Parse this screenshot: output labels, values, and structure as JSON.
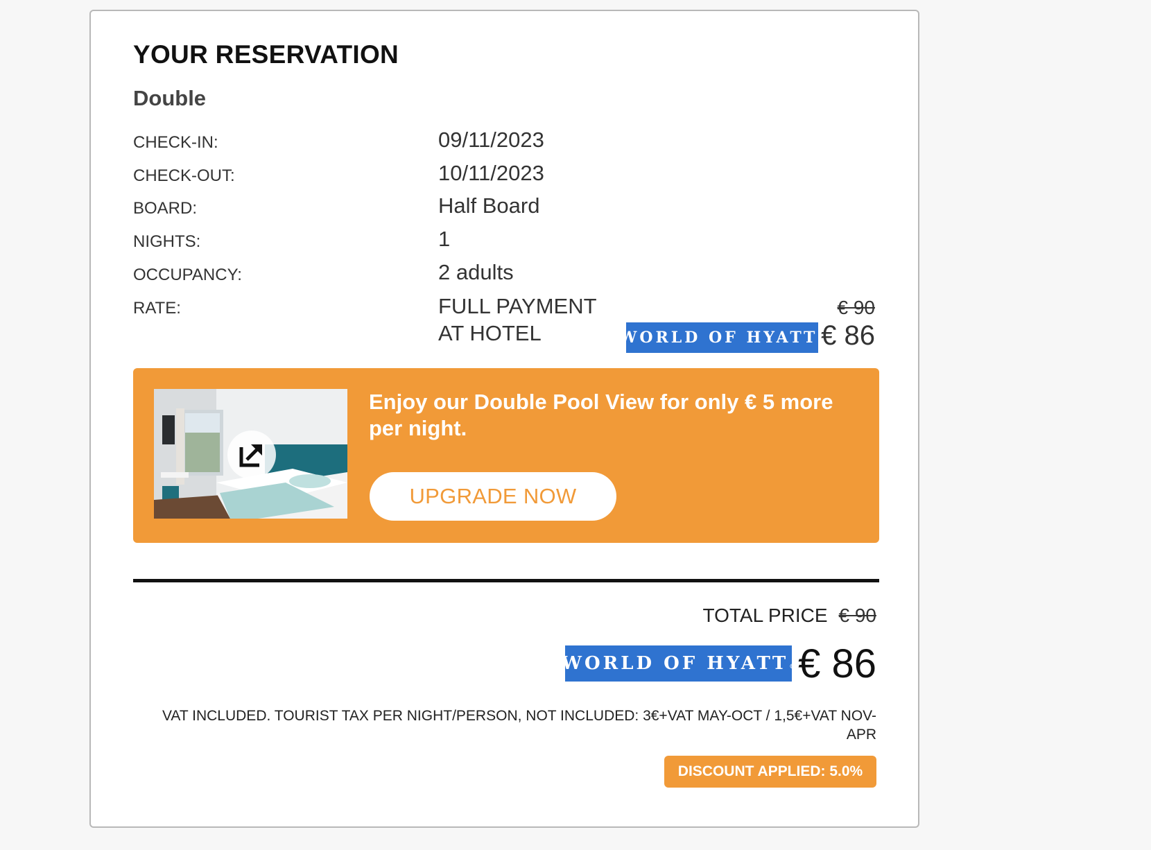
{
  "reservation": {
    "title": "YOUR RESERVATION",
    "room": "Double",
    "details": [
      {
        "label": "CHECK-IN:",
        "value": "09/11/2023"
      },
      {
        "label": "CHECK-OUT:",
        "value": "10/11/2023"
      },
      {
        "label": "BOARD:",
        "value": "Half Board"
      },
      {
        "label": "NIGHTS:",
        "value": "1"
      },
      {
        "label": "OCCUPANCY:",
        "value": "2 adults"
      }
    ],
    "rate": {
      "label": "RATE:",
      "value_line1": "FULL PAYMENT",
      "value_line2": "AT HOTEL",
      "old_price": "€ 90",
      "new_price": "€ 86",
      "badge": "WORLD OF HYATT",
      "badge_mark": "®"
    }
  },
  "upgrade": {
    "text": "Enjoy our Double Pool View for only € 5 more per night.",
    "button_label": "UPGRADE NOW",
    "image_icon": "expand-icon"
  },
  "total": {
    "label": "TOTAL PRICE",
    "old_price": "€ 90",
    "new_price": "€ 86",
    "badge": "WORLD OF HYATT",
    "badge_mark": "®",
    "vat_note": "VAT INCLUDED. TOURIST TAX PER NIGHT/PERSON, NOT INCLUDED: 3€+VAT MAY-OCT / 1,5€+VAT NOV-APR",
    "discount": "DISCOUNT APPLIED: 5.0%"
  },
  "colors": {
    "accent_orange": "#f19a38",
    "hyatt_blue": "#2f73d0"
  }
}
